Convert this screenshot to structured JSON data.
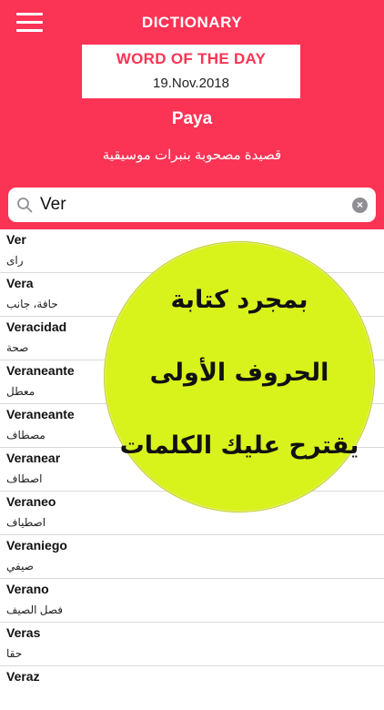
{
  "header": {
    "title": "DICTIONARY",
    "menu_icon": "hamburger-menu-icon"
  },
  "word_of_the_day": {
    "heading": "WORD OF THE DAY",
    "date": "19.Nov.2018",
    "word": "Paya",
    "definition": "قصيدة مصحوبة بنبرات موسيقية"
  },
  "search": {
    "value": "Ver",
    "search_icon": "magnifier-icon",
    "clear_icon": "clear-icon",
    "clear_glyph": "×"
  },
  "words": [
    {
      "term": "Ver",
      "translation": "راى"
    },
    {
      "term": "Vera",
      "translation": "حافة، جانب"
    },
    {
      "term": "Veracidad",
      "translation": "صحة"
    },
    {
      "term": "Veraneante",
      "translation": "معطل"
    },
    {
      "term": "Veraneante",
      "translation": "مصطاف"
    },
    {
      "term": "Veranear",
      "translation": "اصطاف"
    },
    {
      "term": "Veraneo",
      "translation": "اصطياف"
    },
    {
      "term": "Veraniego",
      "translation": "صيفي"
    },
    {
      "term": "Verano",
      "translation": "فصل الصيف"
    },
    {
      "term": "Veras",
      "translation": "حقا"
    },
    {
      "term": "Veraz",
      "translation": ""
    }
  ],
  "promo": {
    "line1": "بمجرد كتابة",
    "line2": "الحروف الأولى",
    "line3": "يقترح عليك الكلمات"
  },
  "colors": {
    "header_background": "#fb3355",
    "promo_circle": "#d8f21c"
  }
}
